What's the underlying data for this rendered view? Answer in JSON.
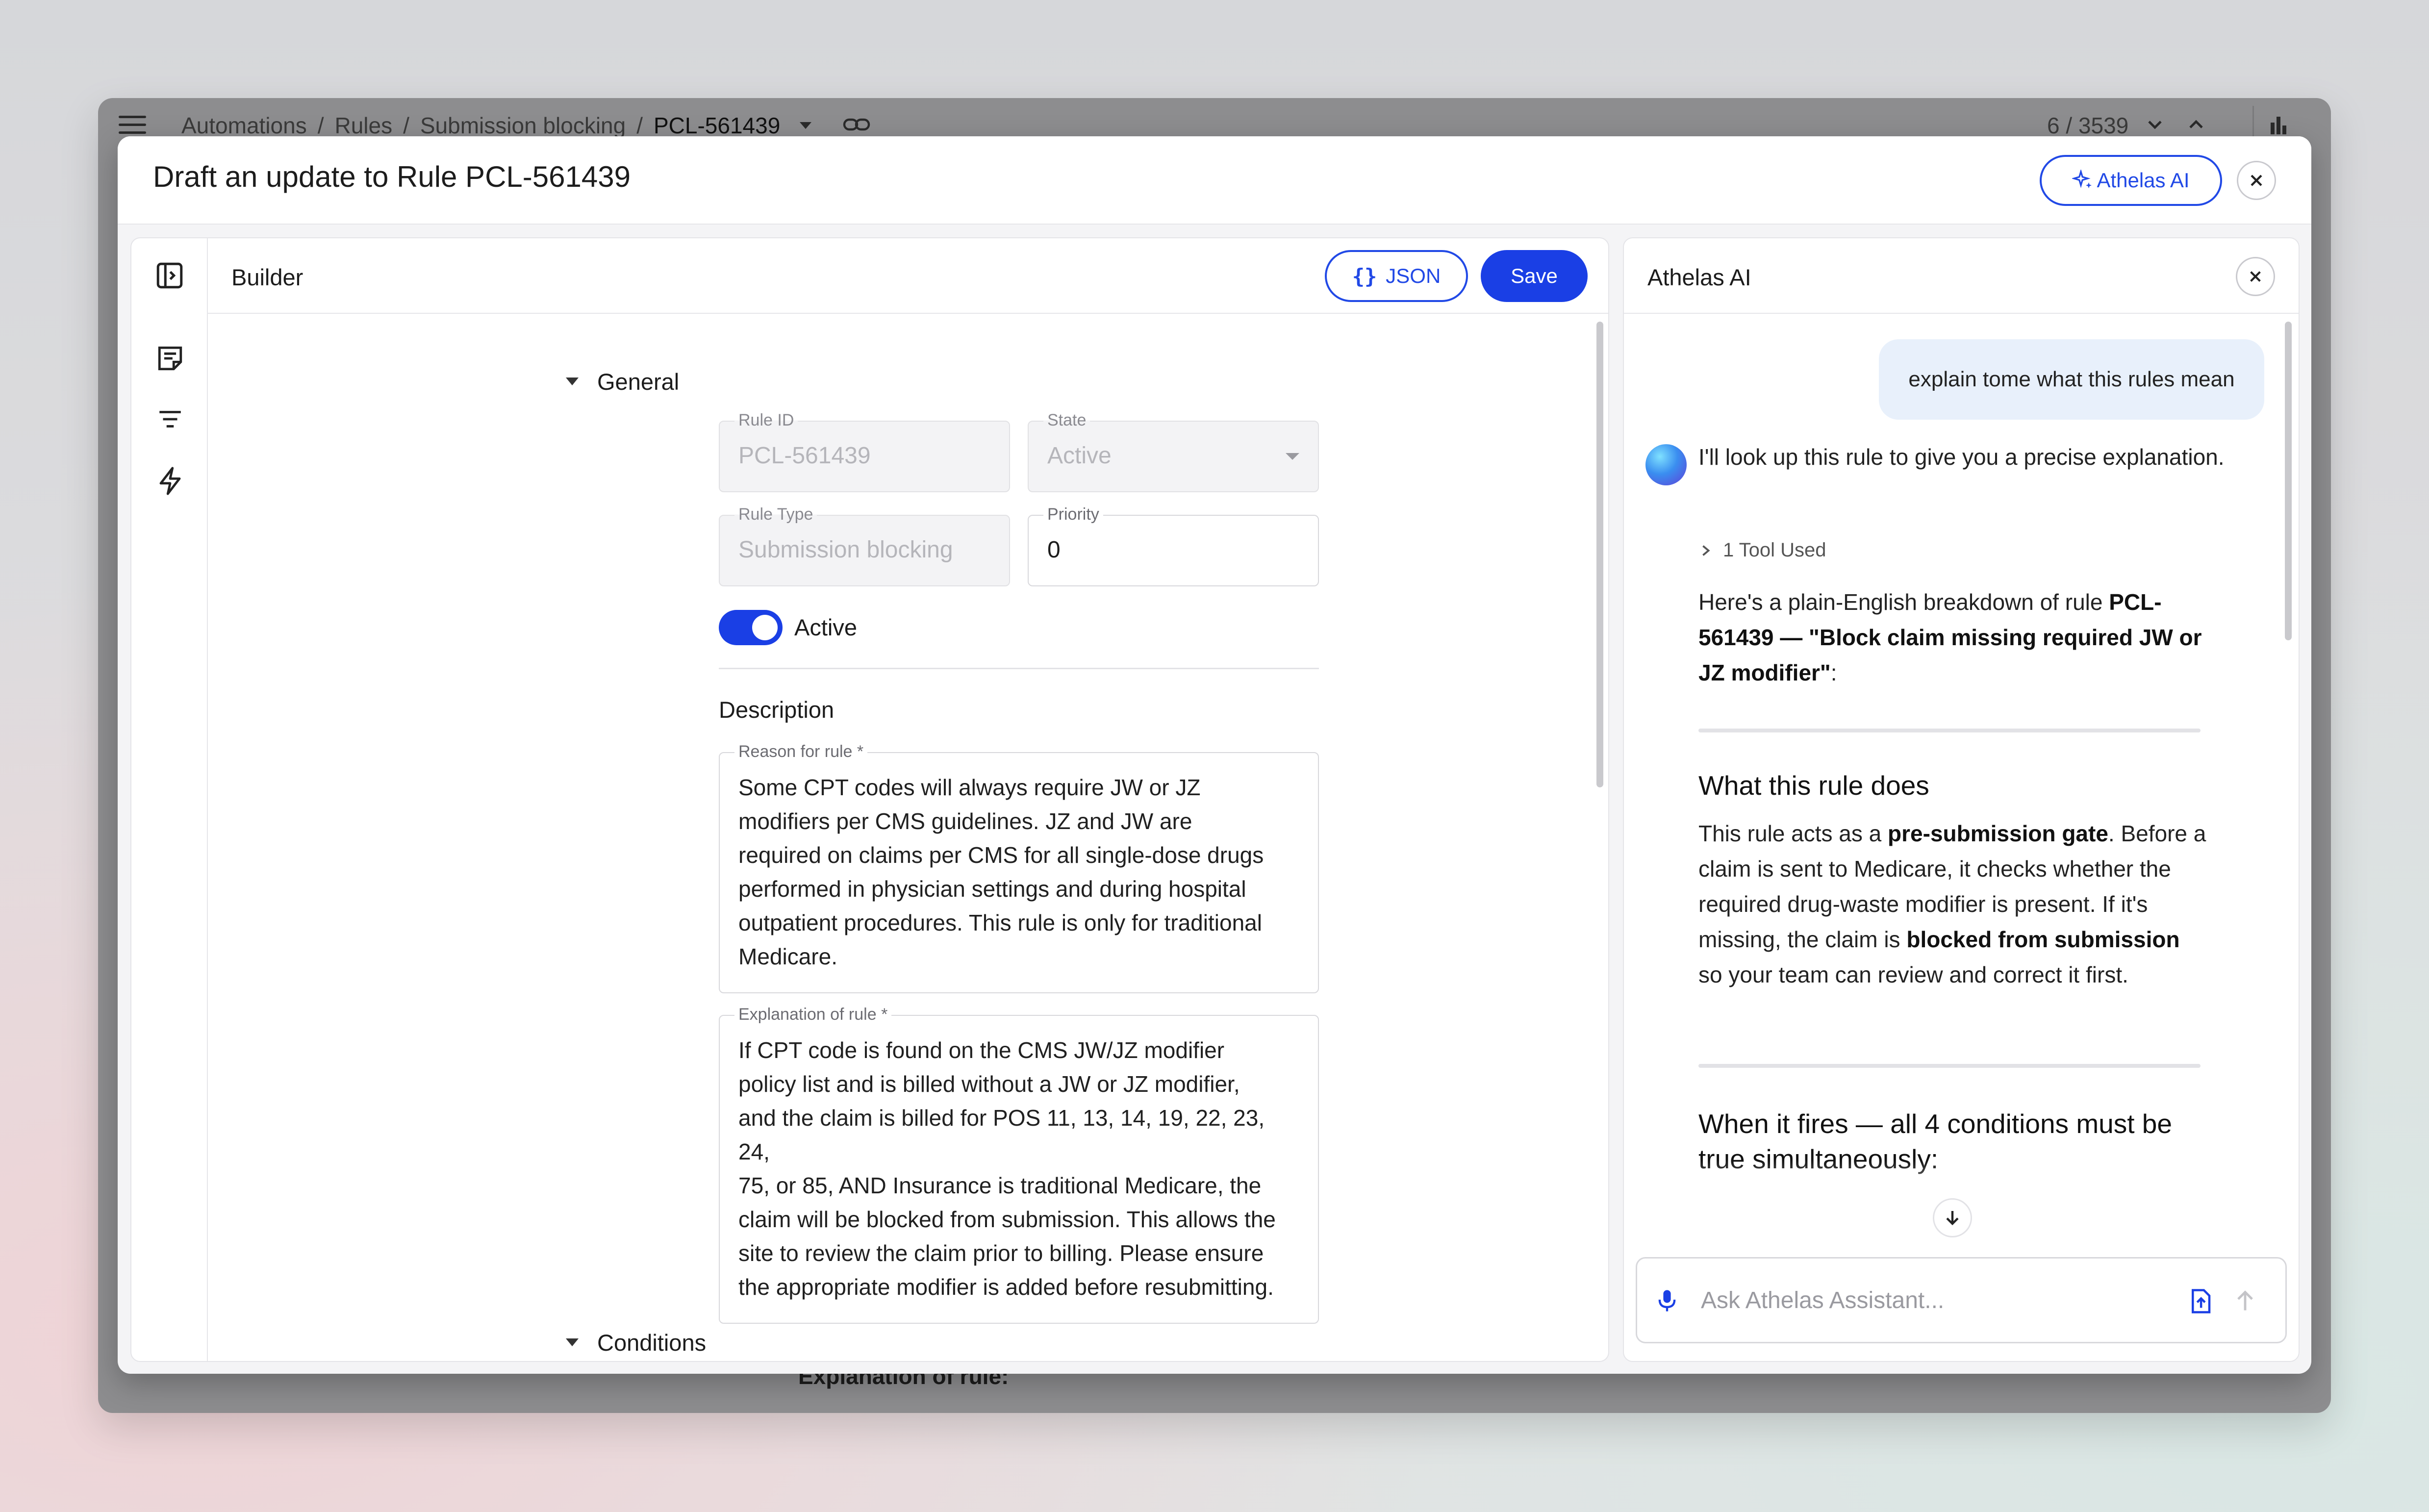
{
  "background_app": {
    "breadcrumbs": [
      "Automations",
      "Rules",
      "Submission blocking",
      "PCL-561439"
    ],
    "pager": "6 / 3539",
    "behind_text": "Explanation of rule:"
  },
  "modal": {
    "title": "Draft an update to Rule PCL-561439",
    "ai_button_label": "Athelas AI"
  },
  "builder": {
    "title": "Builder",
    "json_button_label": "JSON",
    "save_button_label": "Save",
    "general": {
      "heading": "General",
      "rule_id": {
        "label": "Rule ID",
        "value": "PCL-561439"
      },
      "state": {
        "label": "State",
        "value": "Active"
      },
      "rule_type": {
        "label": "Rule Type",
        "value": "Submission blocking"
      },
      "priority": {
        "label": "Priority",
        "value": "0"
      },
      "active_toggle_label": "Active",
      "active_on": true
    },
    "description": {
      "heading": "Description",
      "reason": {
        "label": "Reason for rule *",
        "value": "Some CPT codes will always require JW or JZ\nmodifiers per CMS guidelines. JZ and JW are\nrequired on claims per CMS for all single-dose drugs\nperformed in physician settings and during hospital\noutpatient procedures. This rule is only for traditional\nMedicare."
      },
      "explanation": {
        "label": "Explanation of rule *",
        "value": "If CPT code is found on the CMS JW/JZ modifier\npolicy list and is billed without a JW or JZ modifier,\nand the claim is billed for POS 11, 13, 14, 19, 22, 23, 24,\n75, or 85, AND Insurance is traditional Medicare, the\nclaim will be blocked from submission. This allows the\nsite to review the claim prior to billing. Please ensure\nthe appropriate modifier is added before resubmitting."
      }
    },
    "conditions_heading": "Conditions"
  },
  "ai_panel": {
    "title": "Athelas AI",
    "user_message": "explain tome what this rules mean",
    "assistant_intro": "I'll look up this rule to give you a precise explanation.",
    "tool_used": "1 Tool Used",
    "breakdown_prefix": "Here's a plain-English breakdown of rule ",
    "breakdown_rule": "PCL-561439 — \"Block claim missing required JW or JZ modifier\"",
    "breakdown_suffix": ":",
    "section1_heading": "What this rule does",
    "section1_p1": "This rule acts as a ",
    "section1_b1": "pre-submission gate",
    "section1_p2": ". Before a claim is sent to Medicare, it checks whether the required drug-waste modifier is present. If it's missing, the claim is ",
    "section1_b2": "blocked from submission",
    "section1_p3": " so your team can review and correct it first.",
    "section2_heading": "When it fires — all 4 conditions must be true simultaneously:",
    "input_placeholder": "Ask Athelas Assistant..."
  },
  "colors": {
    "accent": "#1a3fe5",
    "panel_bg": "#ffffff",
    "modal_bg": "#f4f4f6",
    "user_bubble": "#e8f0fb"
  }
}
